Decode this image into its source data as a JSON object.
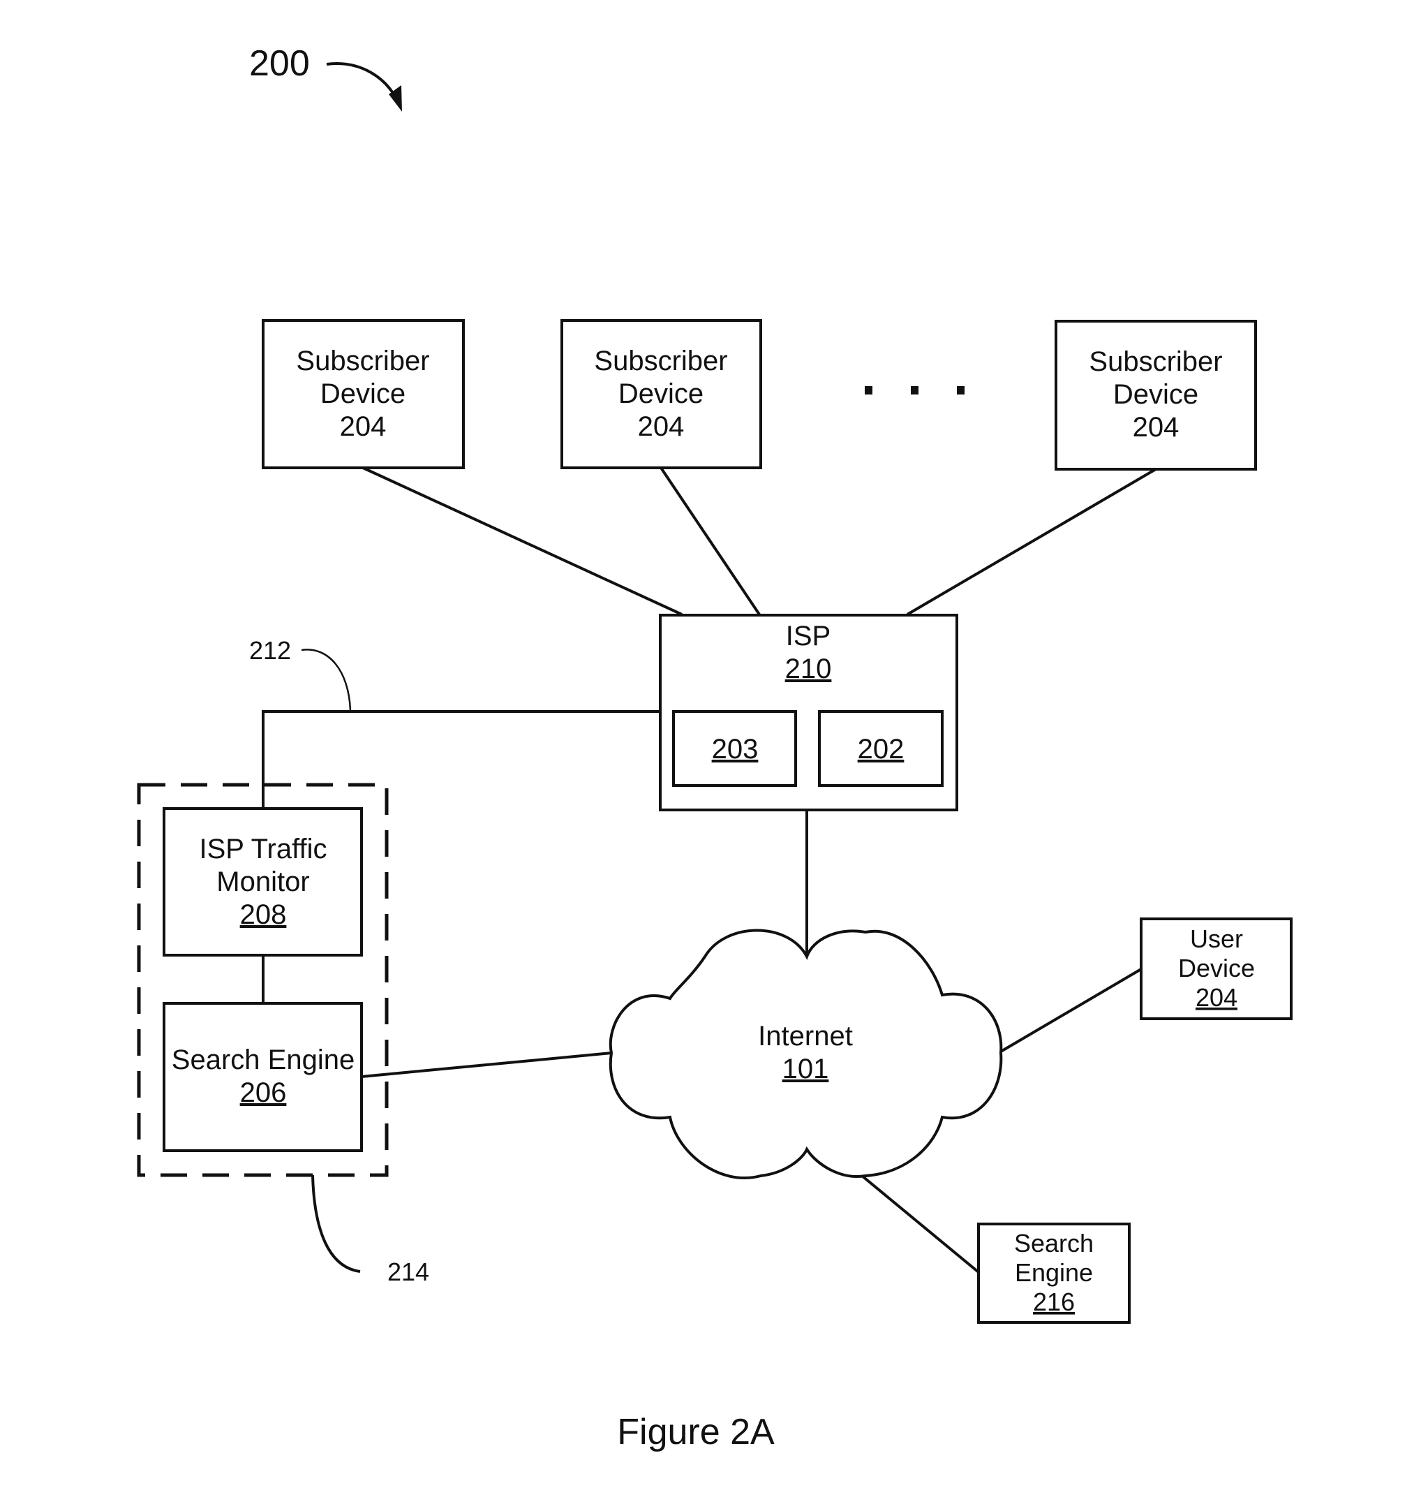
{
  "figure": {
    "reference_number": "200",
    "caption": "Figure 2A"
  },
  "subscriber_devices": [
    {
      "line1": "Subscriber",
      "line2": "Device",
      "ref": "204"
    },
    {
      "line1": "Subscriber",
      "line2": "Device",
      "ref": "204"
    },
    {
      "line1": "Subscriber",
      "line2": "Device",
      "ref": "204"
    }
  ],
  "ellipsis": "...",
  "isp": {
    "label": "ISP",
    "ref": "210",
    "components": [
      "203",
      "202"
    ]
  },
  "link_label": "212",
  "group_label": "214",
  "traffic_monitor": {
    "line1": "ISP Traffic",
    "line2": "Monitor",
    "ref": "208"
  },
  "search_engine_local": {
    "label": "Search Engine",
    "ref": "206"
  },
  "internet": {
    "label": "Internet",
    "ref": "101"
  },
  "user_device": {
    "line1": "User",
    "line2": "Device",
    "ref": "204"
  },
  "search_engine_remote": {
    "line1": "Search",
    "line2": "Engine",
    "ref": "216"
  }
}
